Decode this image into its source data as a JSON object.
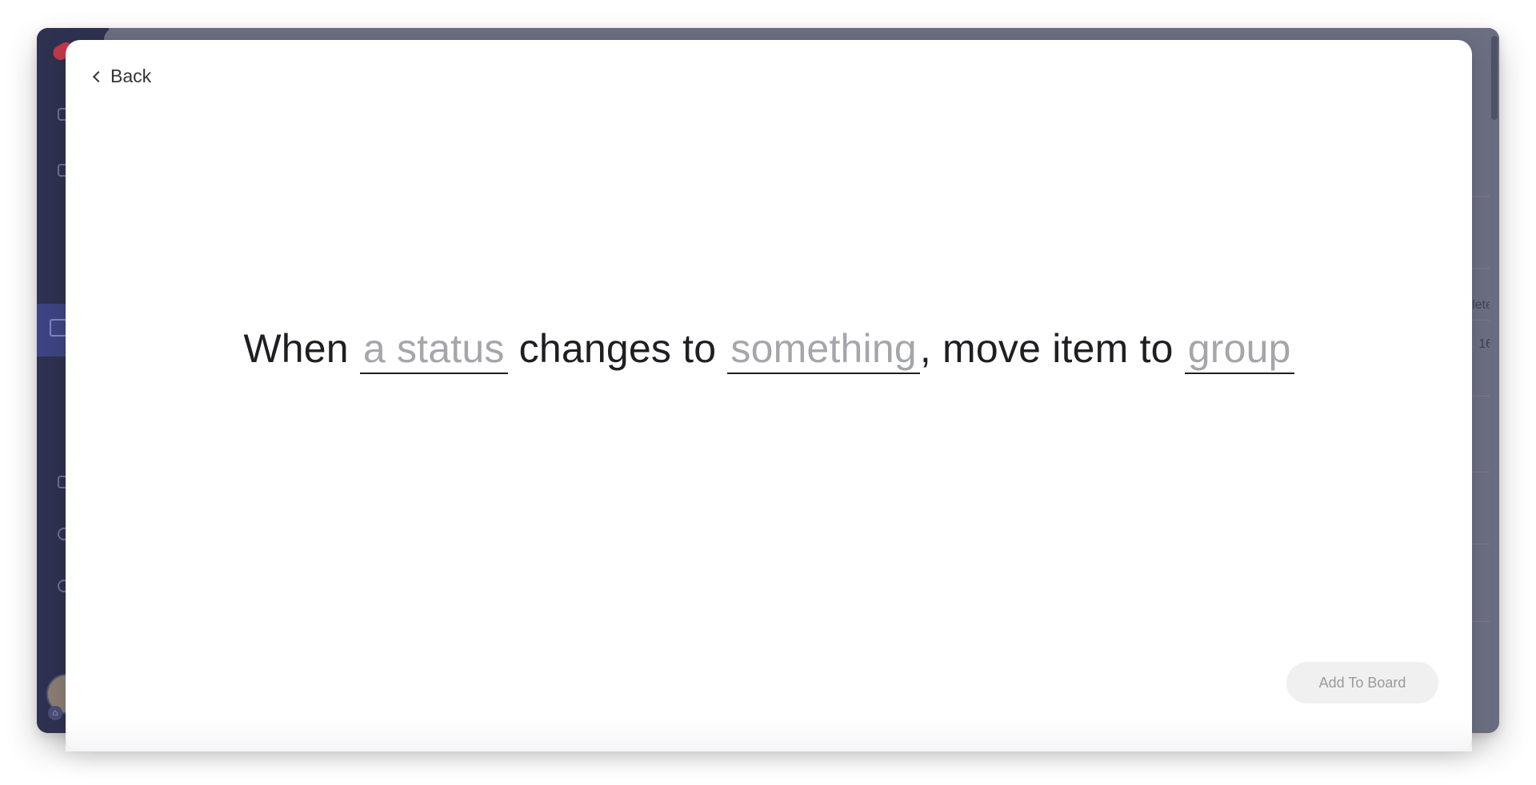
{
  "modal": {
    "back_label": "Back",
    "recipe": {
      "part1": "When",
      "field_status": "a status",
      "part2": "changes to",
      "field_value": "something",
      "part3": ", move item to",
      "field_group": "group"
    },
    "add_button_label": "Add To Board"
  },
  "background": {
    "peek_column_text": "lete",
    "peek_value": "16"
  },
  "colors": {
    "rail": "#2e3150",
    "rail_highlight": "#3d4483",
    "overlay": "#6c6e82",
    "placeholder_text": "#a5a6ab",
    "button_bg": "#f0f0f0"
  }
}
